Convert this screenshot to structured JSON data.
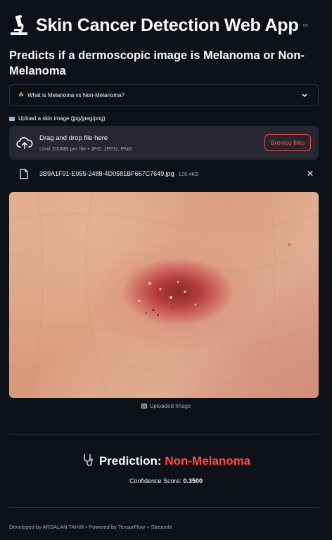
{
  "header": {
    "title": "Skin Cancer Detection Web App",
    "title_icon": "microscope-icon",
    "subtitle": "Predicts if a dermoscopic image is Melanoma or Non-Melanoma"
  },
  "expander": {
    "label": "What is Melanoma vs Non-Melanoma?",
    "icon": "leaf-icon"
  },
  "uploader": {
    "label": "Upload a skin image (jpg/jpeg/png)",
    "drop_text": "Drag and drop file here",
    "limit_text": "Limit 200MB per file • JPG, JPEG, PNG",
    "browse_label": "Browse files"
  },
  "file": {
    "name": "3B9A1F91-E055-2488-4D0581BF667C7649.jpg",
    "size": "128.4KB"
  },
  "image": {
    "caption": "Uploaded Image"
  },
  "result": {
    "prediction_label": "Prediction:",
    "prediction_value": "Non-Melanoma",
    "confidence_label": "Confidence Score:",
    "confidence_value": "0.3500"
  },
  "footer": {
    "text": "Developed by ARSALAN TAHIR • Powered by TensorFlow + Streamlit"
  },
  "colors": {
    "background": "#0e1117",
    "accent": "#ff4b4b",
    "panel": "#262730"
  }
}
